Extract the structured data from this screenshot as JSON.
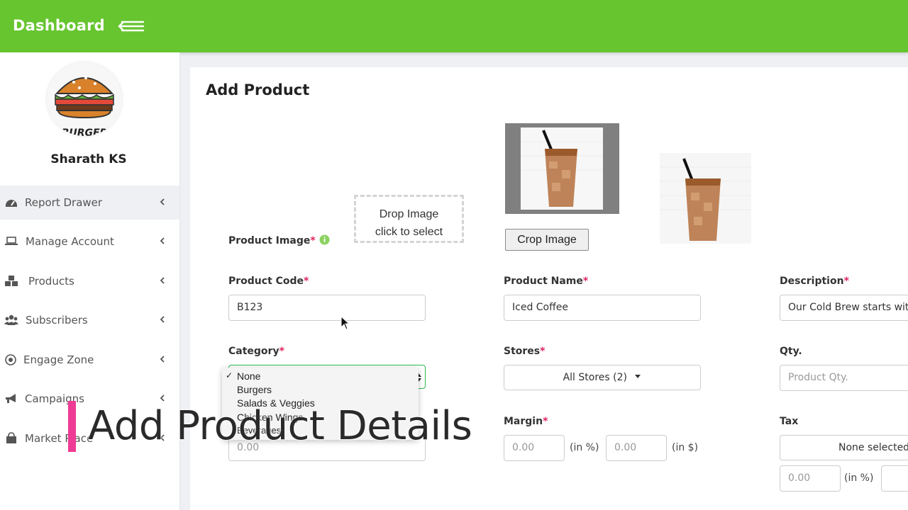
{
  "header": {
    "brand": "Dashboard",
    "accent_color": "#67c52f",
    "menu_icon": "menu-arrow-left-icon"
  },
  "sidebar": {
    "logo_text": "BURGER",
    "user_name": "Sharath KS",
    "items": [
      {
        "label": "Report Drawer",
        "icon": "dashboard-gauge-icon",
        "active": true
      },
      {
        "label": "Manage Account",
        "icon": "laptop-icon"
      },
      {
        "label": "Products",
        "icon": "cubes-icon"
      },
      {
        "label": "Subscribers",
        "icon": "users-icon"
      },
      {
        "label": "Engage Zone",
        "icon": "target-icon"
      },
      {
        "label": "Campaigns",
        "icon": "bullhorn-icon"
      },
      {
        "label": "Market Place",
        "icon": "shopping-bag-icon"
      }
    ]
  },
  "main": {
    "title": "Add Product",
    "product_image": {
      "label": "Product Image",
      "required_mark": "*",
      "dropzone_line1": "Drop Image",
      "dropzone_line2": "click to select",
      "crop_button": "Crop Image"
    },
    "product_code": {
      "label": "Product Code",
      "required_mark": "*",
      "value": "B123"
    },
    "product_name": {
      "label": "Product Name",
      "required_mark": "*",
      "value": "Iced Coffee"
    },
    "description": {
      "label": "Description",
      "required_mark": "*",
      "value": "Our Cold Brew starts with"
    },
    "category": {
      "label": "Category",
      "required_mark": "*",
      "selected": "None",
      "options": [
        "None",
        "Burgers",
        "Salads & Veggies",
        "Chicken Wings",
        "Beverages"
      ]
    },
    "stores": {
      "label": "Stores",
      "required_mark": "*",
      "value": "All Stores (2)"
    },
    "qty": {
      "label": "Qty.",
      "placeholder": "Product Qty."
    },
    "price": {
      "value": "0.00"
    },
    "margin": {
      "label": "Margin",
      "required_mark": "*",
      "percent_value": "0.00",
      "percent_unit": "(in %)",
      "amount_value": "0.00",
      "amount_unit": "(in $)"
    },
    "tax": {
      "label": "Tax",
      "selected": "None selected",
      "percent_value": "0.00",
      "percent_unit": "(in %)"
    }
  },
  "overlay": {
    "caption": "Add Product Details"
  }
}
